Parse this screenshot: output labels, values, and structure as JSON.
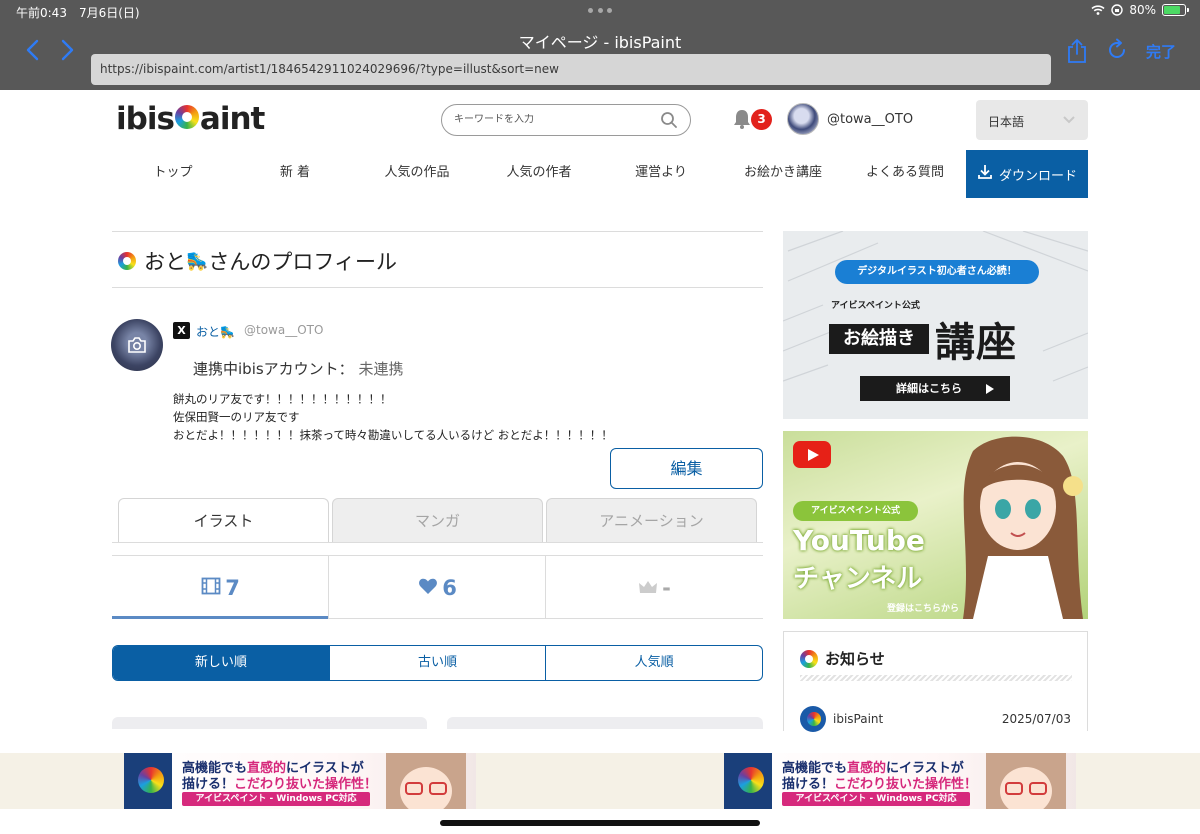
{
  "status": {
    "time": "午前0:43　7月6日(日)",
    "battery": "80%",
    "battery_level": 0.8
  },
  "browser": {
    "title": "マイページ - ibisPaint",
    "url": "https://ibispaint.com/artist1/1846542911024029696/?type=illust&sort=new",
    "done_label": "完了"
  },
  "header": {
    "logo_prefix": "ibis",
    "logo_suffix": "aint",
    "search_placeholder": "キーワードを入力",
    "notification_count": "3",
    "username": "@towa__OTO",
    "language": "日本語"
  },
  "nav": {
    "items": [
      "トップ",
      "新 着",
      "人気の作品",
      "人気の作者",
      "運営より",
      "お絵かき講座",
      "よくある質問"
    ],
    "download_label": "ダウンロード"
  },
  "profile": {
    "title_prefix": "おと",
    "title_emoji": "🛼",
    "title_suffix": "さんのプロフィール",
    "x_name": "おと🛼",
    "x_handle": "@towa__OTO",
    "link_label": "連携中ibisアカウント：",
    "link_state": "未連携",
    "bio": [
      "餅丸のリア友です！！！！！！！！！！！",
      "佐保田賢一のリア友です",
      "おとだよ！！！！！！！抹茶って時々勘違いしてる人いるけど おとだよ！！！！！！"
    ],
    "edit_label": "編集"
  },
  "tabs": [
    "イラスト",
    "マンガ",
    "アニメーション"
  ],
  "stats": {
    "works": "7",
    "likes": "6",
    "rank": "-"
  },
  "sort": [
    "新しい順",
    "古い順",
    "人気順"
  ],
  "sidebar": {
    "banner1": {
      "pill": "デジタルイラスト初心者さん必読！",
      "sub": "アイビスペイント公式",
      "box": "お絵描き",
      "big": "講座",
      "button": "詳細はこちら"
    },
    "banner2": {
      "pill": "アイビスペイント公式",
      "line1": "YouTube",
      "line2": "チャンネル",
      "register": "登録はこちらから"
    },
    "news": {
      "title": "お知らせ",
      "source": "ibisPaint",
      "date": "2025/07/03"
    }
  },
  "ad": {
    "line1_a": "高機能でも",
    "line1_b": "直感的",
    "line1_c": "にイラストが",
    "line2_a": "描ける！",
    "line2_b": "こだわり抜いた操作性！",
    "bar": "アイビスペイント - Windows PC対応"
  }
}
